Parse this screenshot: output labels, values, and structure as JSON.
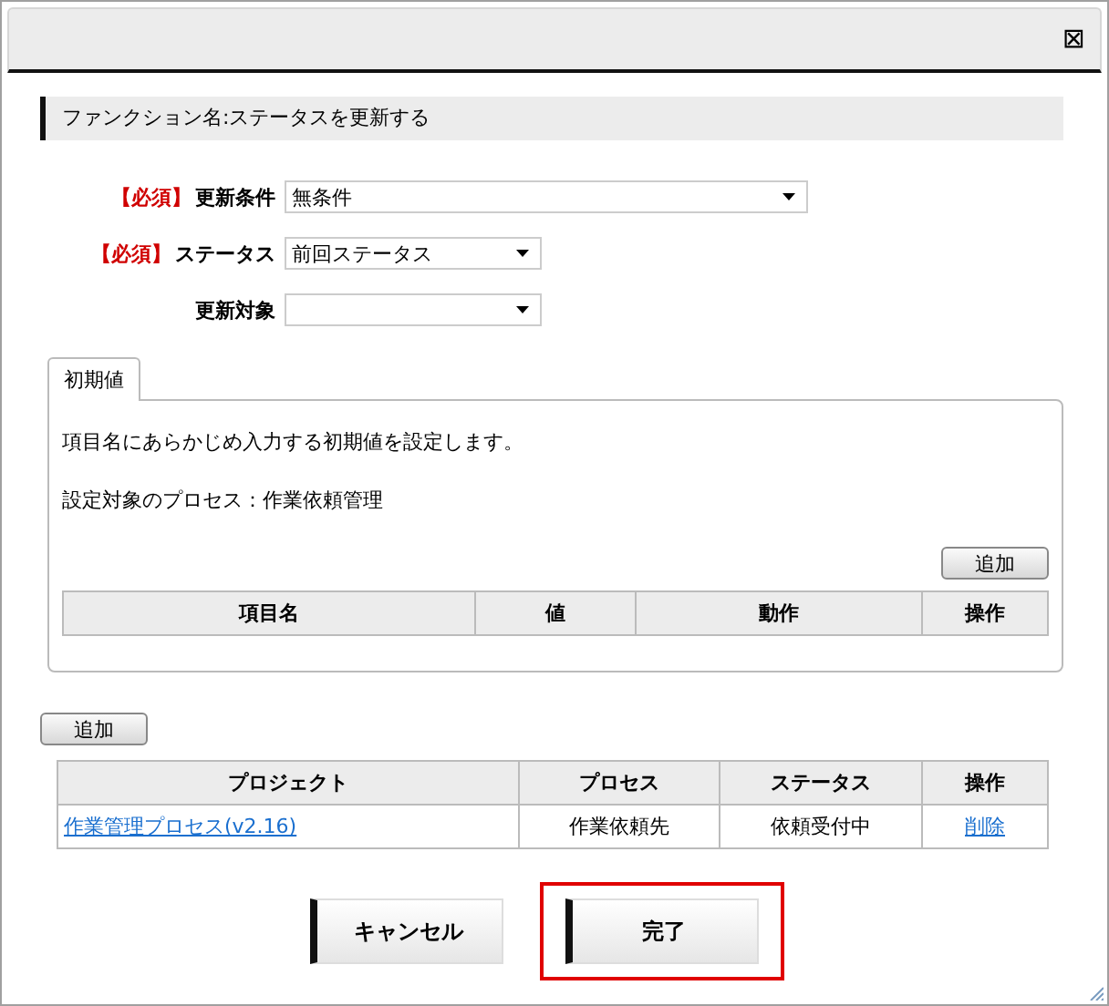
{
  "dialog": {
    "close_icon": "⊠"
  },
  "section_title": "ファンクション名:ステータスを更新する",
  "fields": [
    {
      "required_mark": "【必須】",
      "label": "更新条件",
      "value": "無条件",
      "wide": true
    },
    {
      "required_mark": "【必須】",
      "label": "ステータス",
      "value": "前回ステータス",
      "wide": false
    },
    {
      "label": "更新対象",
      "wide": false
    }
  ],
  "tabs": [
    {
      "label": "初期値",
      "selected": true
    }
  ],
  "panel": {
    "description": "項目名にあらかじめ入力する初期値を設定します。",
    "process_line": "設定対象のプロセス：作業依頼管理",
    "add_button": "追加",
    "table": {
      "columns": [
        "項目名",
        "値",
        "動作",
        "操作"
      ]
    }
  },
  "add_button": "追加",
  "table": {
    "columns": [
      "プロジェクト",
      "プロセス",
      "ステータス",
      "操作"
    ],
    "rows": [
      {
        "project": "作業管理プロセス(v2.16)",
        "process": "作業依頼先",
        "status": "依頼受付中",
        "action": "削除"
      }
    ]
  },
  "buttons": [
    {
      "label": "キャンセル",
      "highlighted": false
    },
    {
      "label": "完了",
      "highlighted": true
    }
  ]
}
